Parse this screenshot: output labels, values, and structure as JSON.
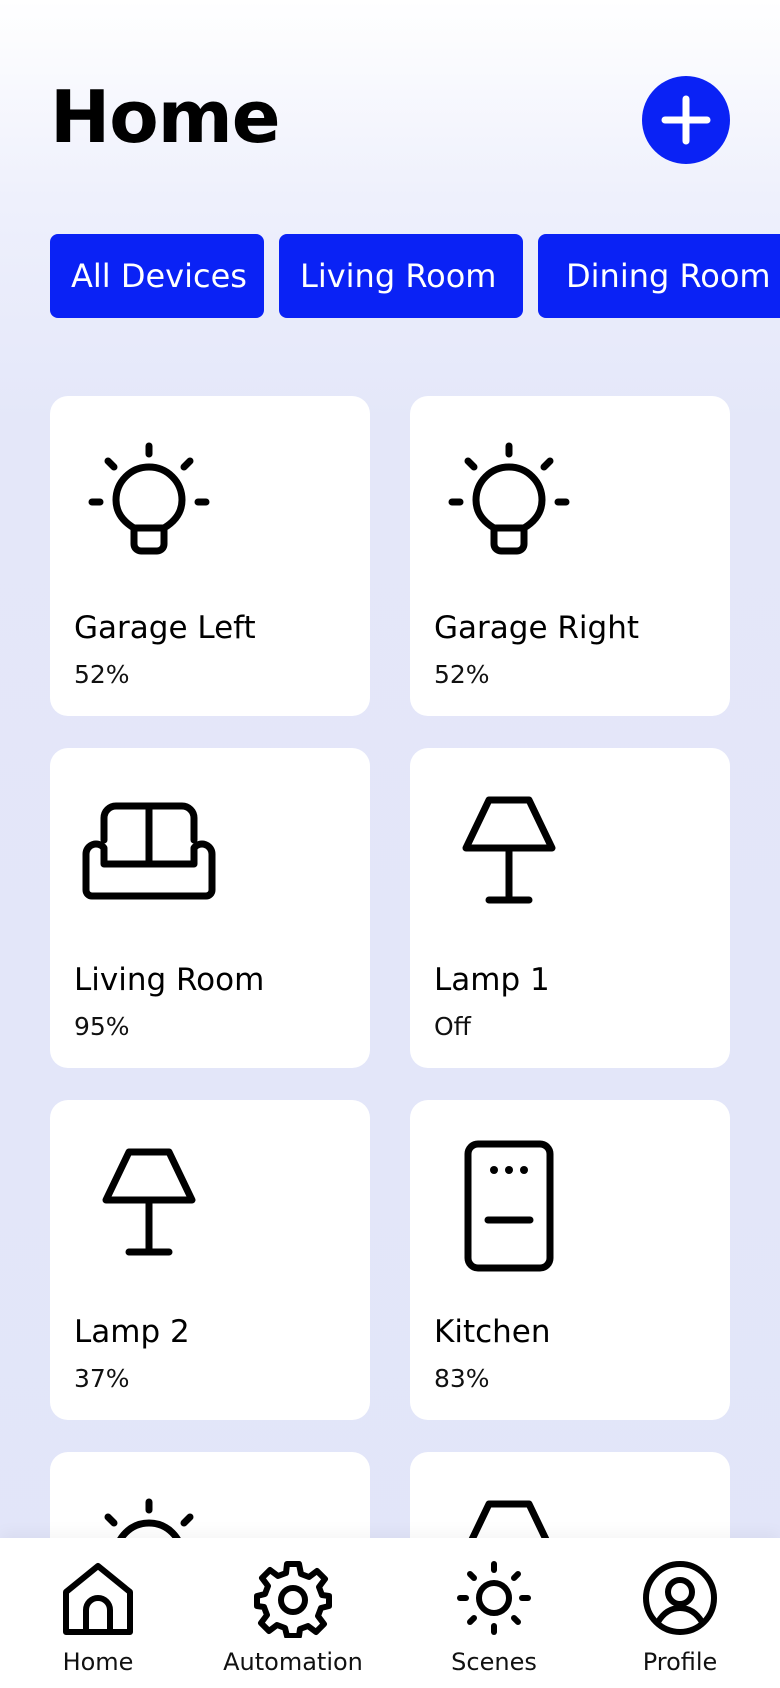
{
  "header": {
    "title": "Home",
    "add_icon": "plus-icon",
    "accent": "#0a22f5"
  },
  "tabs": [
    {
      "label": "All Devices"
    },
    {
      "label": "Living Room"
    },
    {
      "label": "Dining Room"
    }
  ],
  "devices": [
    {
      "name": "Garage Left",
      "value": "52%",
      "icon": "bulb-icon"
    },
    {
      "name": "Garage Right",
      "value": "52%",
      "icon": "bulb-icon"
    },
    {
      "name": "Living Room",
      "value": "95%",
      "icon": "sofa-icon"
    },
    {
      "name": "Lamp 1",
      "value": "Off",
      "icon": "lamp-icon"
    },
    {
      "name": "Lamp 2",
      "value": "37%",
      "icon": "lamp-icon"
    },
    {
      "name": "Kitchen",
      "value": "83%",
      "icon": "oven-icon"
    },
    {
      "name": "",
      "value": "",
      "icon": "bulb-icon"
    },
    {
      "name": "",
      "value": "",
      "icon": "lamp-icon"
    }
  ],
  "nav": [
    {
      "label": "Home",
      "icon": "home-icon"
    },
    {
      "label": "Automation",
      "icon": "gear-icon"
    },
    {
      "label": "Scenes",
      "icon": "sun-icon"
    },
    {
      "label": "Profile",
      "icon": "user-circle-icon"
    }
  ]
}
